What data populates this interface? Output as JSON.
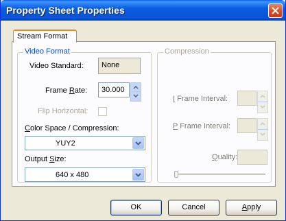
{
  "window": {
    "title": "Property Sheet Properties"
  },
  "tabs": [
    {
      "label": "Stream Format"
    }
  ],
  "video_format": {
    "legend": "Video Format",
    "video_standard_label": "Video Standard:",
    "video_standard_value": "None",
    "frame_rate_label_pre": "Frame ",
    "frame_rate_label_u": "R",
    "frame_rate_label_post": "ate:",
    "frame_rate_value": "30.000",
    "flip_horizontal_label": "Flip Horizontal:",
    "color_space_label_u": "C",
    "color_space_label_post": "olor Space / Compression:",
    "color_space_value": "YUY2",
    "output_size_label_pre": "Output ",
    "output_size_label_u": "S",
    "output_size_label_post": "ize:",
    "output_size_value": "640 x 480"
  },
  "compression": {
    "legend": "Compression",
    "i_frame_label_u": "I",
    "i_frame_label_post": " Frame Interval:",
    "i_frame_value": "",
    "p_frame_label_u": "P",
    "p_frame_label_post": " Frame Interval:",
    "p_frame_value": "",
    "quality_label_u": "Q",
    "quality_label_post": "uality:",
    "quality_value": ""
  },
  "buttons": {
    "ok": "OK",
    "cancel": "Cancel",
    "apply_u": "A",
    "apply_post": "pply"
  }
}
